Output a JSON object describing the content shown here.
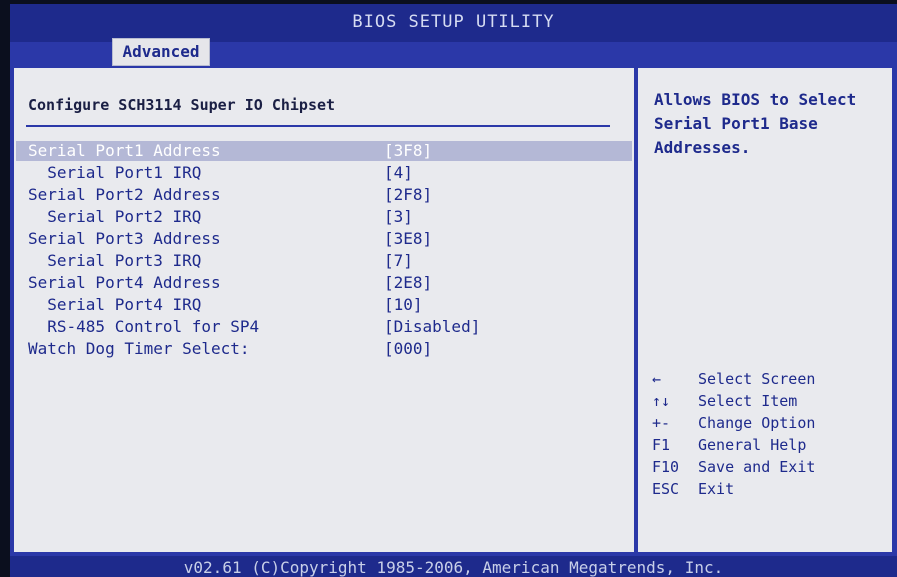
{
  "title": "BIOS SETUP UTILITY",
  "tabs": [
    {
      "label": "Advanced",
      "active": true
    }
  ],
  "main": {
    "heading": "Configure SCH3114 Super IO Chipset",
    "rows": [
      {
        "label": "Serial Port1 Address",
        "value": "[3F8]"
      },
      {
        "label": "  Serial Port1 IRQ",
        "value": "[4]"
      },
      {
        "label": "Serial Port2 Address",
        "value": "[2F8]"
      },
      {
        "label": "  Serial Port2 IRQ",
        "value": "[3]"
      },
      {
        "label": "Serial Port3 Address",
        "value": "[3E8]"
      },
      {
        "label": "  Serial Port3 IRQ",
        "value": "[7]"
      },
      {
        "label": "Serial Port4 Address",
        "value": "[2E8]"
      },
      {
        "label": "  Serial Port4 IRQ",
        "value": "[10]"
      },
      {
        "label": "  RS-485 Control for SP4",
        "value": "[Disabled]"
      },
      {
        "label": "Watch Dog Timer Select:",
        "value": "[000]"
      }
    ]
  },
  "help": {
    "text": "Allows BIOS to Select Serial Port1 Base Addresses.",
    "keys": [
      {
        "key": "←",
        "desc": "Select Screen"
      },
      {
        "key": "↑↓",
        "desc": "Select Item"
      },
      {
        "key": "+-",
        "desc": "Change Option"
      },
      {
        "key": "F1",
        "desc": "General Help"
      },
      {
        "key": "F10",
        "desc": "Save and Exit"
      },
      {
        "key": "ESC",
        "desc": "Exit"
      }
    ]
  },
  "footer": {
    "copyright": "v02.61 (C)Copyright 1985-2006, American Megatrends, Inc."
  },
  "colors": {
    "frame": "#2b38a8",
    "title_bar": "#1e2a8c",
    "panel_bg": "#e9eaee",
    "text": "#1e2a8c",
    "selected_text": "#ffffff"
  }
}
